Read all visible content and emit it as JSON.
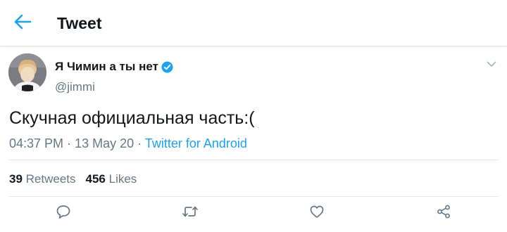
{
  "header": {
    "title": "Tweet",
    "back_icon": "arrow-left-icon",
    "accent": "#1da1f2"
  },
  "tweet": {
    "author": {
      "name": "Я Чимин а ты нет",
      "handle": "@jimmi",
      "verified": true,
      "avatar_icon": "profile-photo"
    },
    "text": "Скучная официальная часть:(",
    "time": "04:37 PM",
    "date": "13 May 20",
    "source": "Twitter for Android",
    "stats": {
      "retweets_count": "39",
      "retweets_label": "Retweets",
      "likes_count": "456",
      "likes_label": "Likes"
    },
    "actions": [
      "reply-icon",
      "retweet-icon",
      "like-icon",
      "share-icon"
    ]
  },
  "colors": {
    "text_primary": "#14171a",
    "text_secondary": "#657786",
    "link": "#1da1f2",
    "divider": "#e1e8ed"
  }
}
